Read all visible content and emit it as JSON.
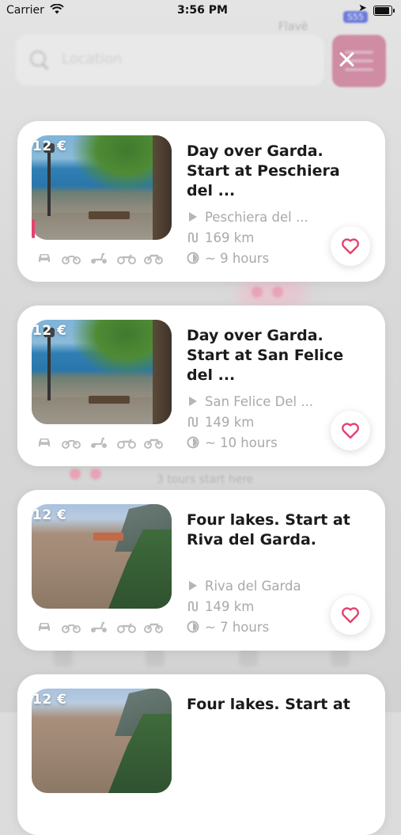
{
  "status_bar": {
    "carrier": "Carrier",
    "time": "3:56 PM"
  },
  "background": {
    "search_placeholder": "Location",
    "map_label_top": "Flavè",
    "route_badge": "S55",
    "bottom_hint": "3 tours start here"
  },
  "tours": [
    {
      "price": "12 €",
      "title": "Day over Garda. Start at Peschiera del ...",
      "start": "Peschiera del ...",
      "distance": "169 km",
      "duration": "~ 9 hours",
      "image": "garda-terrace"
    },
    {
      "price": "12 €",
      "title": "Day over Garda. Start at San Felice del ...",
      "start": "San Felice Del ...",
      "distance": "149 km",
      "duration": "~ 10 hours",
      "image": "garda-terrace"
    },
    {
      "price": "12 €",
      "title": "Four lakes. Start at Riva del Garda.",
      "start": "Riva del Garda",
      "distance": "149 km",
      "duration": "~ 7 hours",
      "image": "lake-cliffs"
    },
    {
      "price": "12 €",
      "title": "Four lakes. Start at",
      "image": "lake-cliffs"
    }
  ],
  "vehicle_icons": [
    "car-icon",
    "motorbike-icon",
    "scooter-icon",
    "quad-icon",
    "sportbike-icon"
  ],
  "colors": {
    "accent": "#e5426f",
    "meta_gray": "#a9a9a9",
    "title": "#1b1b1b"
  }
}
